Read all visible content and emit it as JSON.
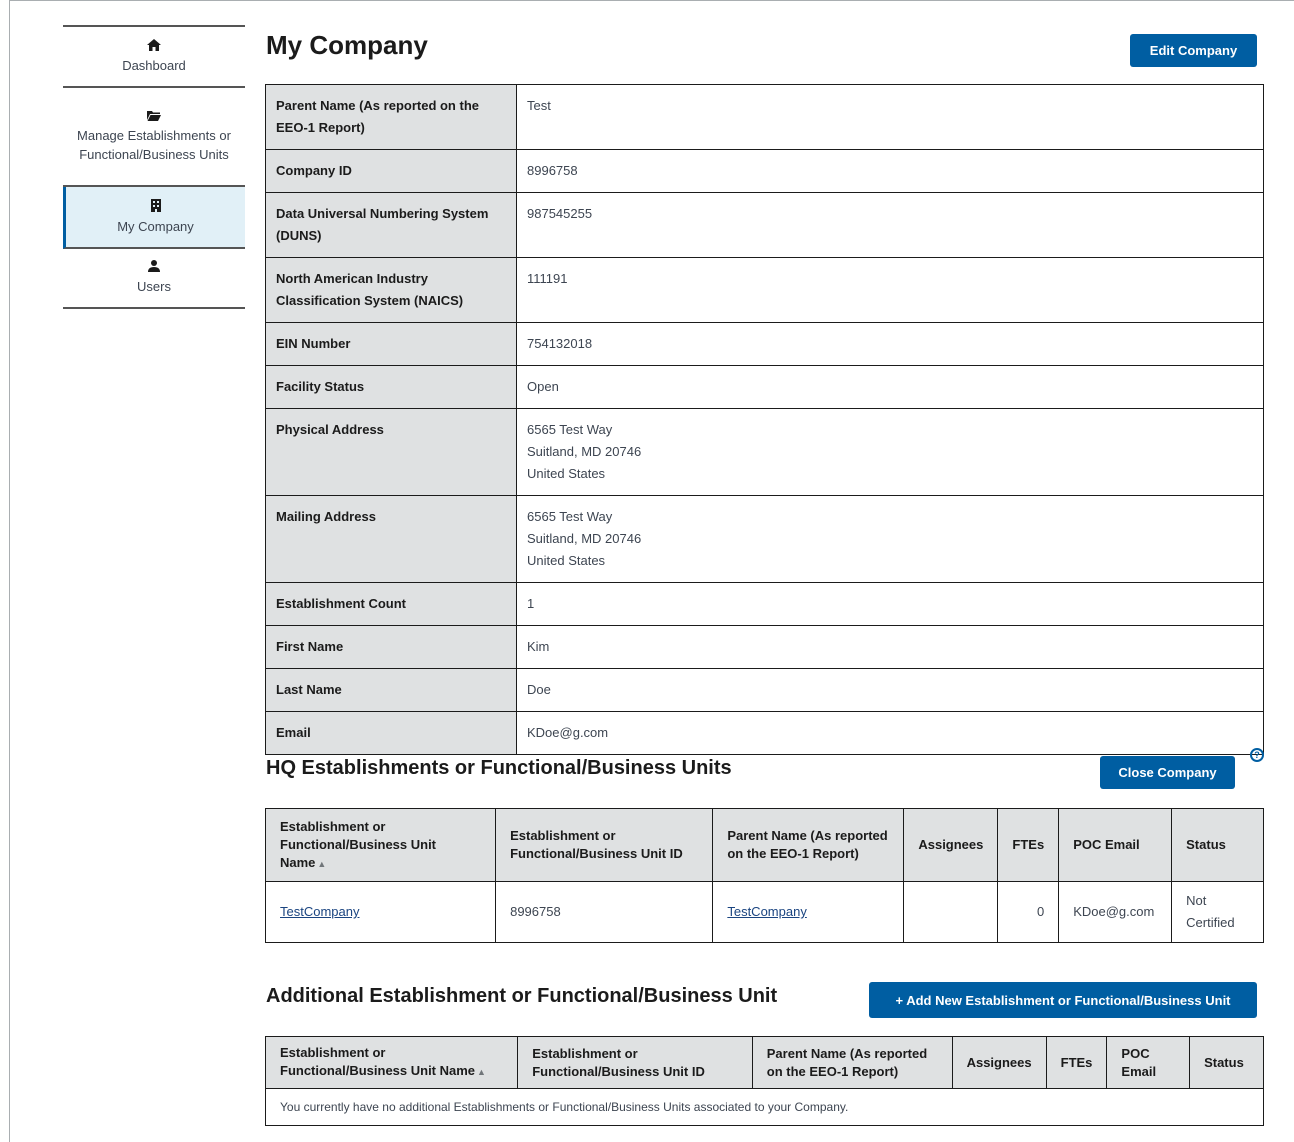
{
  "sidebar": {
    "items": [
      {
        "label": "Dashboard",
        "icon": "home-icon",
        "glyph": "⌂"
      },
      {
        "label": "Manage Establishments or Functional/Business Units",
        "icon": "folder-icon",
        "glyph": "▬"
      },
      {
        "label": "My Company",
        "icon": "building-icon",
        "glyph": "▦",
        "active": true
      },
      {
        "label": "Users",
        "icon": "user-icon",
        "glyph": "▲"
      }
    ]
  },
  "page": {
    "title": "My Company",
    "edit_button": "Edit Company"
  },
  "details": [
    {
      "label": "Parent Name (As reported on the EEO-1 Report)",
      "value": "Test"
    },
    {
      "label": "Company ID",
      "value": "8996758"
    },
    {
      "label": "Data Universal Numbering System (DUNS)",
      "value": "987545255"
    },
    {
      "label": "North American Industry Classification System (NAICS)",
      "value": "111191"
    },
    {
      "label": "EIN Number",
      "value": "754132018"
    },
    {
      "label": "Facility Status",
      "value": "Open"
    },
    {
      "label": "Physical Address",
      "lines": [
        "6565 Test Way",
        "Suitland, MD 20746",
        "United States"
      ]
    },
    {
      "label": "Mailing Address",
      "lines": [
        "6565 Test Way",
        "Suitland, MD 20746",
        "United States"
      ]
    },
    {
      "label": "Establishment Count",
      "value": "1"
    },
    {
      "label": "First Name",
      "value": "Kim"
    },
    {
      "label": "Last Name",
      "value": "Doe"
    },
    {
      "label": "Email",
      "value": "KDoe@g.com"
    }
  ],
  "hq": {
    "title": "HQ Establishments or Functional/Business Units",
    "close_button": "Close Company",
    "help_glyph": "?",
    "columns": [
      "Establishment or Functional/Business Unit Name",
      "Establishment or Functional/Business Unit ID",
      "Parent Name (As reported on the EEO-1 Report)",
      "Assignees",
      "FTEs",
      "POC Email",
      "Status"
    ],
    "rows": [
      {
        "name": "TestCompany",
        "id": "8996758",
        "parent": "TestCompany",
        "assignees": "",
        "ftes": "0",
        "poc_email": "KDoe@g.com",
        "status": "Not Certified"
      }
    ]
  },
  "additional": {
    "title": "Additional Establishment or Functional/Business Unit",
    "add_button": "+ Add New Establishment or Functional/Business Unit",
    "columns": [
      "Establishment or Functional/Business Unit Name",
      "Establishment or Functional/Business Unit ID",
      "Parent Name (As reported on the EEO-1 Report)",
      "Assignees",
      "FTEs",
      "POC Email",
      "Status"
    ],
    "empty_message": "You currently have no additional Establishments or Functional/Business Units associated to your Company."
  },
  "sort_glyph": "▲",
  "colors": {
    "primary": "#005ea2",
    "header_bg": "#dfe1e2",
    "active_bg": "#e1f0f7",
    "link": "#1a4480"
  }
}
